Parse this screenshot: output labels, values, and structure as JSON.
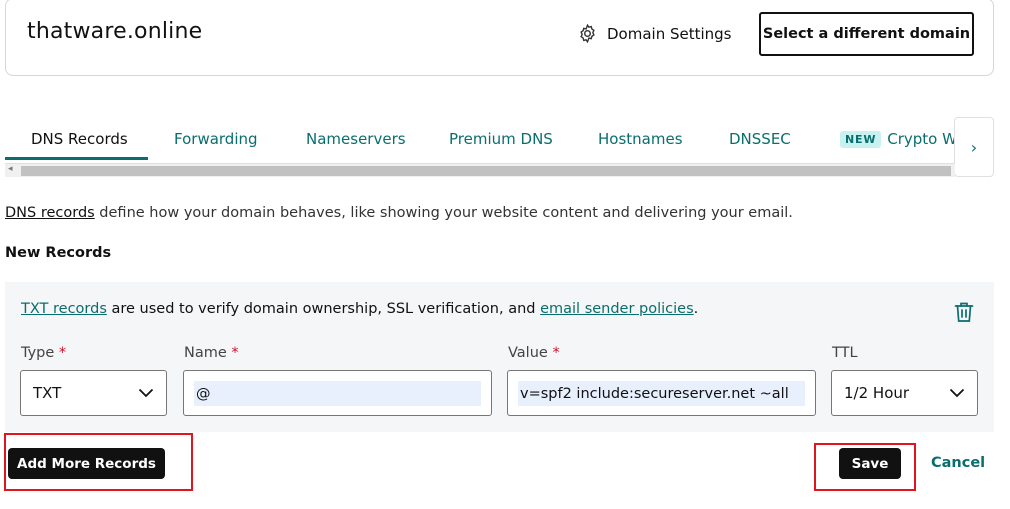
{
  "header": {
    "domain": "thatware.online",
    "domain_settings_label": "Domain Settings",
    "select_domain_label": "Select a different domain"
  },
  "tabs": [
    {
      "label": "DNS Records",
      "active": true
    },
    {
      "label": "Forwarding"
    },
    {
      "label": "Nameservers"
    },
    {
      "label": "Premium DNS"
    },
    {
      "label": "Hostnames"
    },
    {
      "label": "DNSSEC"
    },
    {
      "label": "Crypto Wallet",
      "badge": "NEW"
    }
  ],
  "intro": {
    "link": "DNS records",
    "text": " define how your domain behaves, like showing your website content and delivering your email."
  },
  "new_records": {
    "heading": "New Records",
    "info": {
      "link1": "TXT records",
      "middle": " are used to verify domain ownership, SSL verification, and ",
      "link2": "email sender policies",
      "end": "."
    },
    "fields": {
      "type": {
        "label": "Type",
        "required": "*",
        "value": "TXT"
      },
      "name": {
        "label": "Name",
        "required": "*",
        "value": "@"
      },
      "value": {
        "label": "Value",
        "required": "*",
        "value": "v=spf2 include:secureserver.net ~all"
      },
      "ttl": {
        "label": "TTL",
        "value": "1/2 Hour"
      }
    }
  },
  "actions": {
    "add_more": "Add More Records",
    "save": "Save",
    "cancel": "Cancel"
  },
  "colors": {
    "accent": "#0a6e6e",
    "primary_button": "#111111",
    "highlight": "#e0161e",
    "badge_bg": "#c7f2ef"
  },
  "icons": [
    "gear-icon",
    "chevron-right-icon",
    "trash-icon",
    "chevron-down-icon"
  ]
}
